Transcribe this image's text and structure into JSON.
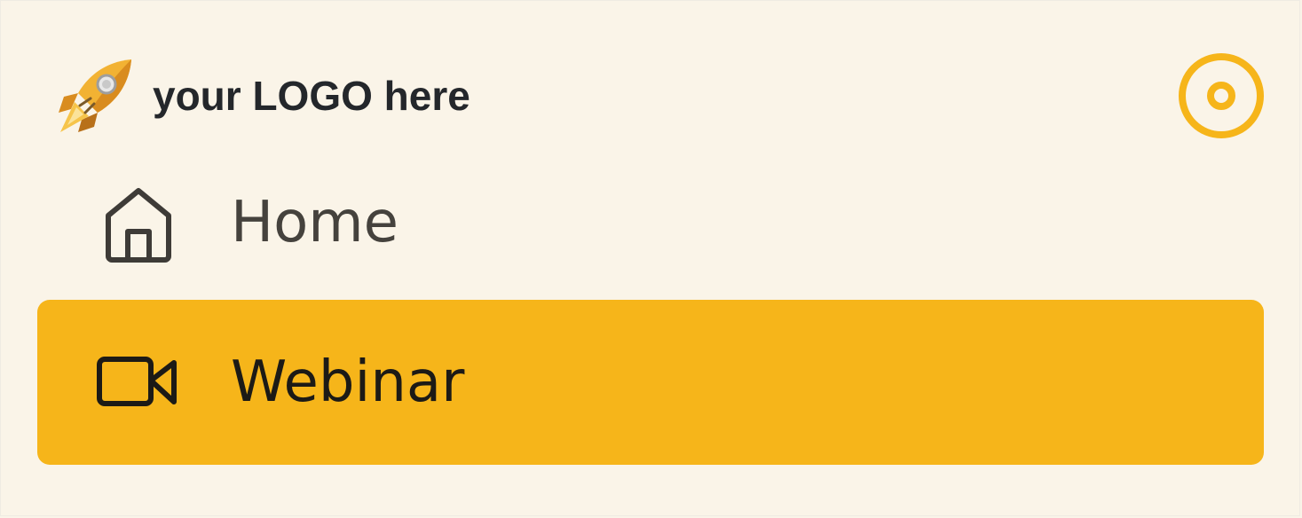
{
  "colors": {
    "background": "#FAF4E8",
    "accent": "#F6B51A",
    "text_primary": "#24272B",
    "text_nav": "#45423D",
    "text_active": "#1C1A16"
  },
  "header": {
    "logo_icon": "rocket-icon",
    "logo_text": "your LOGO here",
    "toggle_icon": "target-circle-icon"
  },
  "nav": {
    "items": [
      {
        "label": "Home",
        "icon": "home-icon",
        "active": false
      },
      {
        "label": "Webinar",
        "icon": "video-camera-icon",
        "active": true
      }
    ]
  }
}
